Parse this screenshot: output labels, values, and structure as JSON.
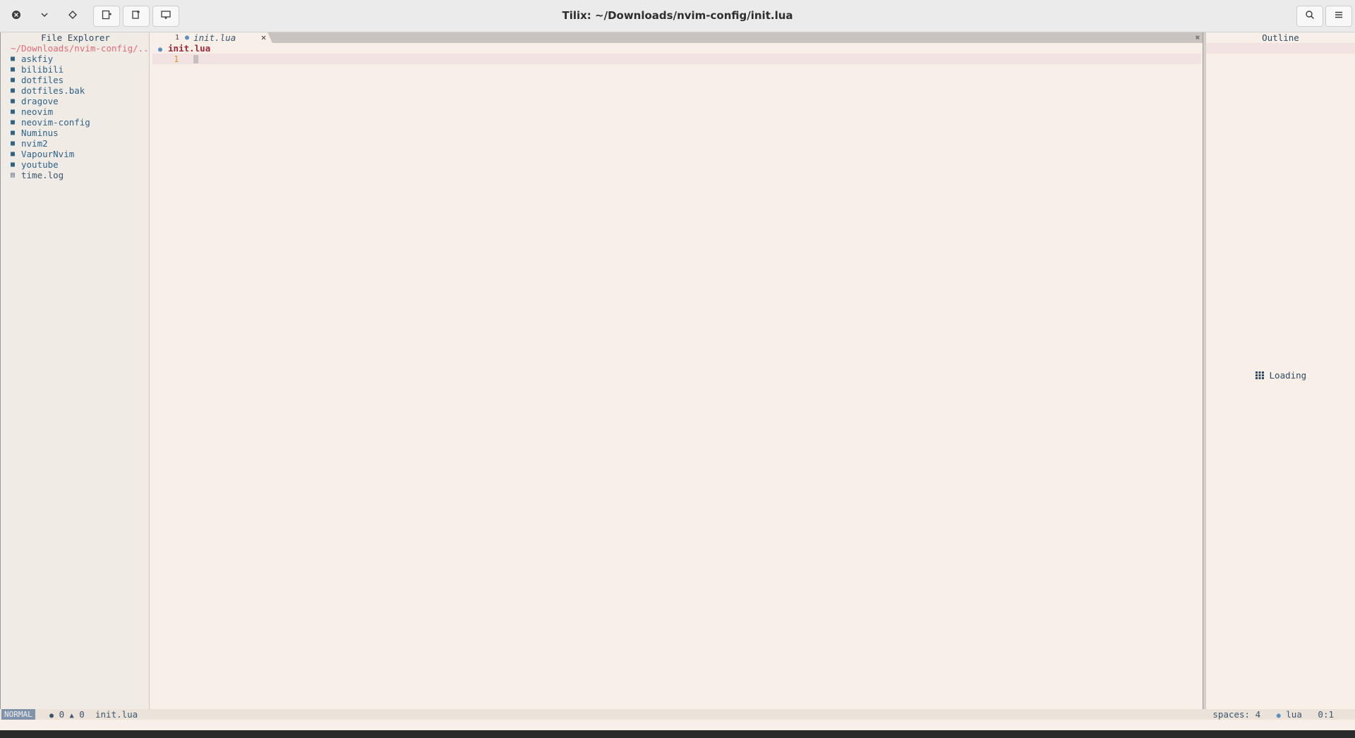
{
  "window": {
    "title": "Tilix: ~/Downloads/nvim-config/init.lua"
  },
  "explorer": {
    "title": "File Explorer",
    "path": "~/Downloads/nvim-config/..",
    "items": [
      {
        "label": "askfiy",
        "kind": "folder"
      },
      {
        "label": "bilibili",
        "kind": "folder"
      },
      {
        "label": "dotfiles",
        "kind": "folder"
      },
      {
        "label": "dotfiles.bak",
        "kind": "folder"
      },
      {
        "label": "dragove",
        "kind": "folder"
      },
      {
        "label": "neovim",
        "kind": "folder"
      },
      {
        "label": "neovim-config",
        "kind": "folder"
      },
      {
        "label": "Numinus",
        "kind": "folder"
      },
      {
        "label": "nvim2",
        "kind": "folder"
      },
      {
        "label": "VapourNvim",
        "kind": "folder"
      },
      {
        "label": "youtube",
        "kind": "folder"
      },
      {
        "label": "time.log",
        "kind": "file"
      }
    ]
  },
  "tabline": {
    "tab": {
      "number": "1",
      "name": "init.lua",
      "close": "✕"
    },
    "close_all": "✖"
  },
  "editor": {
    "winbar_file": "init.lua",
    "line_number": "1"
  },
  "outline": {
    "title": "Outline",
    "loading": "Loading"
  },
  "statusline": {
    "mode": "NORMAL",
    "errors": "0",
    "warnings": "0",
    "file": "init.lua",
    "indent": "spaces: 4",
    "filetype": "lua",
    "position": "0:1"
  },
  "colors": {
    "background": "#f7efe8",
    "accent_blue": "#2e6488",
    "path_pink": "#e06a7a",
    "filename_red": "#a0283a",
    "line_number": "#d89c2e",
    "mode_bg": "#7f94ab"
  }
}
